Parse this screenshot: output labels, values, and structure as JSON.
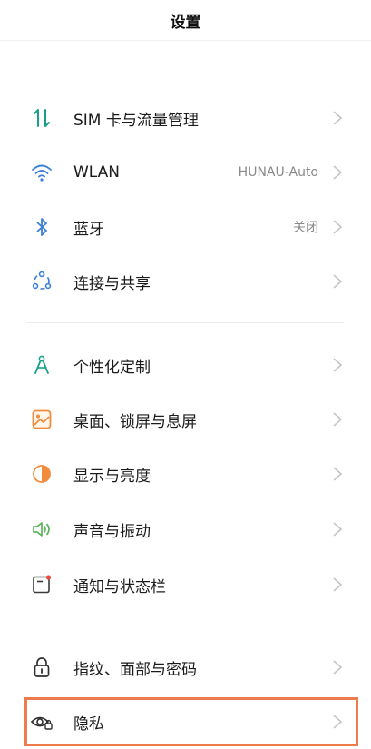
{
  "header": {
    "title": "设置"
  },
  "items": [
    {
      "label": "SIM 卡与流量管理",
      "value": ""
    },
    {
      "label": "WLAN",
      "value": "HUNAU-Auto"
    },
    {
      "label": "蓝牙",
      "value": "关闭"
    },
    {
      "label": "连接与共享",
      "value": ""
    },
    {
      "label": "个性化定制",
      "value": ""
    },
    {
      "label": "桌面、锁屏与息屏",
      "value": ""
    },
    {
      "label": "显示与亮度",
      "value": ""
    },
    {
      "label": "声音与振动",
      "value": ""
    },
    {
      "label": "通知与状态栏",
      "value": ""
    },
    {
      "label": "指纹、面部与密码",
      "value": ""
    },
    {
      "label": "隐私",
      "value": ""
    }
  ],
  "icons": [
    "sim-traffic-icon",
    "wifi-icon",
    "bluetooth-icon",
    "connection-share-icon",
    "personalize-icon",
    "wallpaper-icon",
    "display-brightness-icon",
    "sound-icon",
    "notification-icon",
    "lock-icon",
    "privacy-icon"
  ],
  "colors": {
    "accent": "#19a08b",
    "blue": "#3d7fd6",
    "orange": "#f08c3c",
    "green": "#5ab55a",
    "highlight": "#ec7b4d",
    "chevron": "#c4c4c4"
  }
}
